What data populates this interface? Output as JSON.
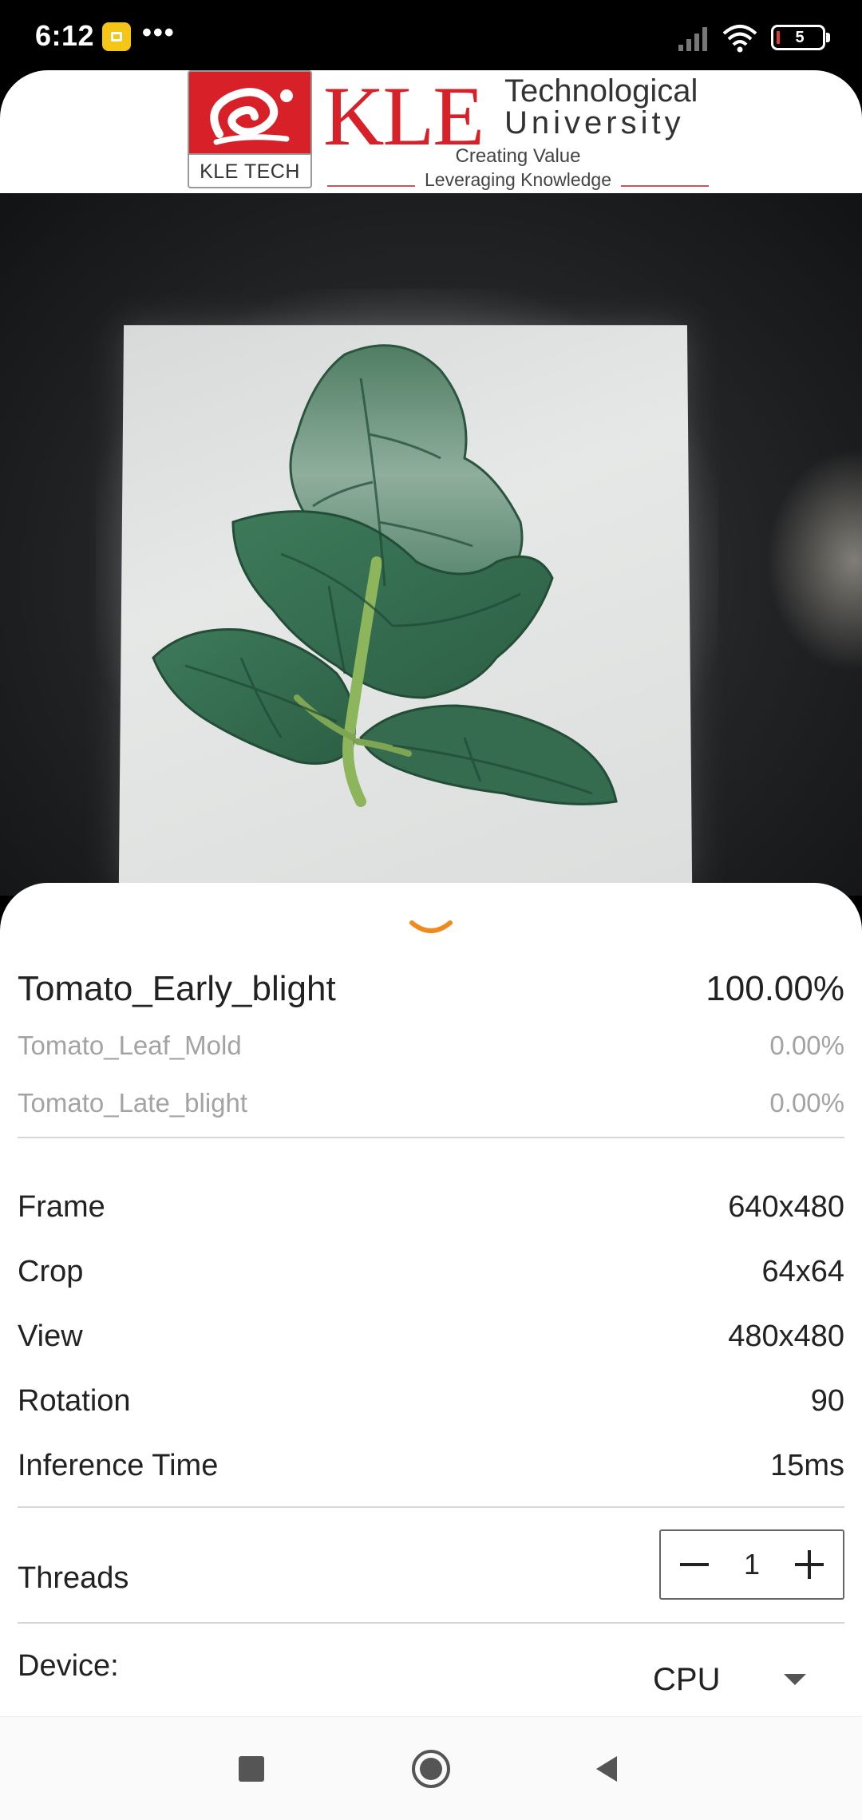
{
  "status_bar": {
    "time": "6:12",
    "more": "•••",
    "battery_level": "5"
  },
  "header": {
    "badge_text": "KLE TECH",
    "logo_word": "KLE",
    "logo_line1": "Technological",
    "logo_line2": "University",
    "tagline1": "Creating Value",
    "tagline2": "Leveraging Knowledge"
  },
  "predictions": [
    {
      "label": "Tomato_Early_blight",
      "value": "100.00%"
    },
    {
      "label": "Tomato_Leaf_Mold",
      "value": "0.00%"
    },
    {
      "label": "Tomato_Late_blight",
      "value": "0.00%"
    }
  ],
  "info": {
    "frame_label": "Frame",
    "frame_value": "640x480",
    "crop_label": "Crop",
    "crop_value": "64x64",
    "view_label": "View",
    "view_value": "480x480",
    "rotation_label": "Rotation",
    "rotation_value": "90",
    "inference_label": "Inference Time",
    "inference_value": "15ms"
  },
  "threads": {
    "label": "Threads",
    "value": "1"
  },
  "device": {
    "label": "Device:",
    "value": "CPU"
  },
  "colors": {
    "brand_red": "#d72027",
    "chevron_orange": "#f08a1c",
    "secondary_text": "#a3a3a3"
  }
}
